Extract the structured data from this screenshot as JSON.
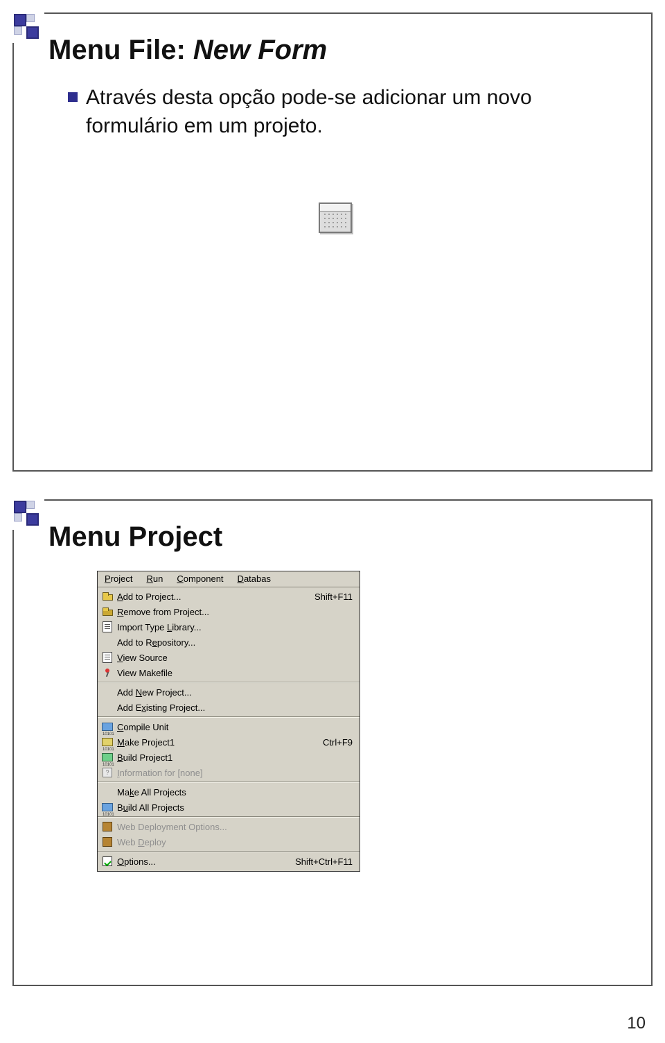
{
  "page_number": "10",
  "slide1": {
    "title_plain": "Menu File: ",
    "title_em": "New Form",
    "bullet": "Através desta opção pode-se adicionar um novo formulário em um projeto."
  },
  "slide2": {
    "title": "Menu Project",
    "menubar": {
      "m1": "Project",
      "m2": "Run",
      "m3": "Component",
      "m4": "Databas"
    },
    "items": {
      "add_to_project": {
        "label": "Add to Project...",
        "shortcut": "Shift+F11"
      },
      "remove_from_project": {
        "label": "Remove from Project..."
      },
      "import_type_library": {
        "label": "Import Type Library..."
      },
      "add_to_repository": {
        "label": "Add to Repository..."
      },
      "view_source": {
        "label": "View Source"
      },
      "view_makefile": {
        "label": "View Makefile"
      },
      "add_new_project": {
        "label": "Add New Project..."
      },
      "add_existing_project": {
        "label": "Add Existing Project..."
      },
      "compile_unit": {
        "label": "Compile Unit"
      },
      "make_project1": {
        "label": "Make Project1",
        "shortcut": "Ctrl+F9"
      },
      "build_project1": {
        "label": "Build Project1"
      },
      "information_for_none": {
        "label": "Information for [none]"
      },
      "make_all_projects": {
        "label": "Make All Projects"
      },
      "build_all_projects": {
        "label": "Build All Projects"
      },
      "web_deploy_options": {
        "label": "Web Deployment Options..."
      },
      "web_deploy": {
        "label": "Web Deploy"
      },
      "options": {
        "label": "Options...",
        "shortcut": "Shift+Ctrl+F11"
      }
    }
  }
}
